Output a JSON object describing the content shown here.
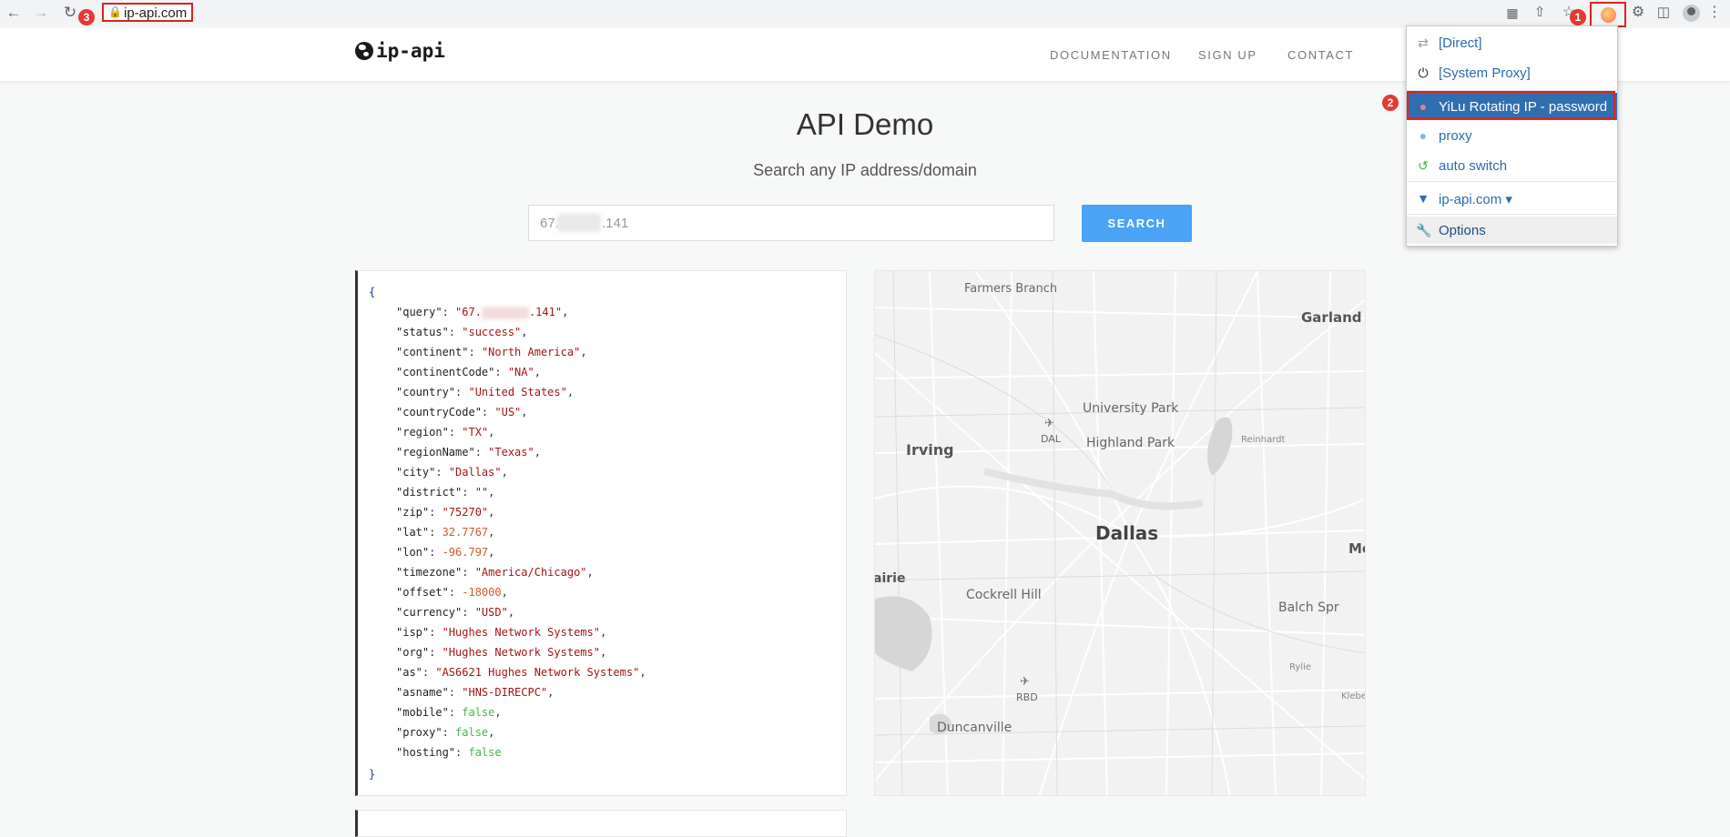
{
  "browser": {
    "url": "ip-api.com",
    "badges": [
      "1",
      "2",
      "3"
    ]
  },
  "site": {
    "logo": "ip-api",
    "nav": [
      "DOCUMENTATION",
      "SIGN UP",
      "CONTACT"
    ]
  },
  "page": {
    "title": "API Demo",
    "subtitle": "Search any IP address/domain",
    "search_value_start": "67.",
    "search_value_end": ".141",
    "search_button": "SEARCH"
  },
  "json": {
    "open": "{",
    "close": "}",
    "query_prefix": "\"67.",
    "query_suffix": ".141\"",
    "rows": [
      {
        "key": "\"status\"",
        "value": "\"success\"",
        "type": "s",
        "comma": ","
      },
      {
        "key": "\"continent\"",
        "value": "\"North America\"",
        "type": "s",
        "comma": ","
      },
      {
        "key": "\"continentCode\"",
        "value": "\"NA\"",
        "type": "s",
        "comma": ","
      },
      {
        "key": "\"country\"",
        "value": "\"United States\"",
        "type": "s",
        "comma": ","
      },
      {
        "key": "\"countryCode\"",
        "value": "\"US\"",
        "type": "s",
        "comma": ","
      },
      {
        "key": "\"region\"",
        "value": "\"TX\"",
        "type": "s",
        "comma": ","
      },
      {
        "key": "\"regionName\"",
        "value": "\"Texas\"",
        "type": "s",
        "comma": ","
      },
      {
        "key": "\"city\"",
        "value": "\"Dallas\"",
        "type": "s",
        "comma": ","
      },
      {
        "key": "\"district\"",
        "value": "\"\"",
        "type": "s",
        "comma": ","
      },
      {
        "key": "\"zip\"",
        "value": "\"75270\"",
        "type": "s",
        "comma": ","
      },
      {
        "key": "\"lat\"",
        "value": "32.7767",
        "type": "n",
        "comma": ","
      },
      {
        "key": "\"lon\"",
        "value": "-96.797",
        "type": "n",
        "comma": ","
      },
      {
        "key": "\"timezone\"",
        "value": "\"America/Chicago\"",
        "type": "s",
        "comma": ","
      },
      {
        "key": "\"offset\"",
        "value": "-18000",
        "type": "n",
        "comma": ","
      },
      {
        "key": "\"currency\"",
        "value": "\"USD\"",
        "type": "s",
        "comma": ","
      },
      {
        "key": "\"isp\"",
        "value": "\"Hughes Network Systems\"",
        "type": "s",
        "comma": ","
      },
      {
        "key": "\"org\"",
        "value": "\"Hughes Network Systems\"",
        "type": "s",
        "comma": ","
      },
      {
        "key": "\"as\"",
        "value": "\"AS6621 Hughes Network Systems\"",
        "type": "s",
        "comma": ","
      },
      {
        "key": "\"asname\"",
        "value": "\"HNS-DIRECPC\"",
        "type": "s",
        "comma": ","
      },
      {
        "key": "\"mobile\"",
        "value": "false",
        "type": "b",
        "comma": ","
      },
      {
        "key": "\"proxy\"",
        "value": "false",
        "type": "b",
        "comma": ","
      },
      {
        "key": "\"hosting\"",
        "value": "false",
        "type": "b",
        "comma": ""
      }
    ]
  },
  "map": {
    "labels": [
      "Farmers Branch",
      "Garland",
      "University Park",
      "Irving",
      "DAL",
      "Highland Park",
      "Reinhardt",
      "Dallas",
      "airie",
      "Cockrell Hill",
      "Balch Spr",
      "Me",
      "RBD",
      "Rylie",
      "Klebe",
      "Duncanville"
    ]
  },
  "proxy_menu": {
    "items": [
      {
        "label": "[Direct]",
        "icon": "swap-arrows-icon"
      },
      {
        "label": "[System Proxy]",
        "icon": "power-icon"
      },
      {
        "label": "YiLu Rotating IP - password",
        "icon": "globe-icon"
      },
      {
        "label": "proxy",
        "icon": "globe-icon"
      },
      {
        "label": "auto switch",
        "icon": "retweet-icon"
      },
      {
        "label": "ip-api.com ▾",
        "icon": "filter-icon"
      },
      {
        "label": "Options",
        "icon": "wrench-icon"
      }
    ]
  },
  "colors": {
    "accent": "#4aa3f5",
    "menu_active": "#2f6fb0",
    "highlight_red": "#e02020"
  }
}
